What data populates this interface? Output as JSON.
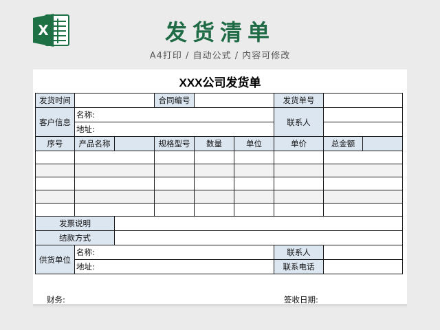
{
  "header": {
    "title": "发货清单",
    "subtitle": "A4打印 / 自动公式 / 内容可修改",
    "icon": "excel-icon",
    "accent": "#1f6b45"
  },
  "doc": {
    "title": "XXX公司发货单",
    "ship_time": "发货时间",
    "contract_no": "合同编号",
    "ship_no": "发货单号",
    "customer_info": "客户信息",
    "name_label": "名称:",
    "addr_label": "地址:",
    "contact": "联系人",
    "columns": [
      "序号",
      "产品名称",
      "规格型号",
      "数量",
      "单位",
      "单价",
      "总金额"
    ],
    "invoice": "发票说明",
    "payment": "结款方式",
    "supplier": "供货单位",
    "supplier_name": "名称:",
    "supplier_addr": "地址:",
    "supplier_contact": "联系人",
    "supplier_phone": "联系电话",
    "finance": "财务:",
    "sign_date": "签收日期:",
    "label_bg": "#dce6f1",
    "alt_row_bg": "#f2f2f2"
  }
}
